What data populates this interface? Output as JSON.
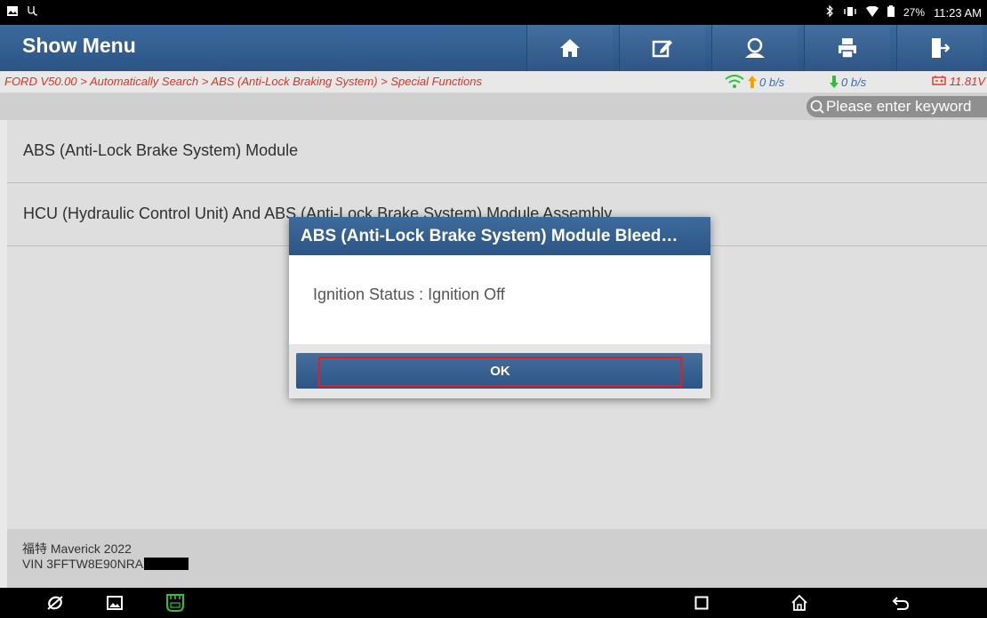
{
  "statusbar": {
    "battery": "27%",
    "time": "11:23 AM"
  },
  "header": {
    "title": "Show Menu"
  },
  "breadcrumb": {
    "path": "FORD V50.00 > Automatically Search > ABS (Anti-Lock Braking System) > Special Functions"
  },
  "network": {
    "upload": "0 b/s",
    "download": "0 b/s",
    "voltage": "11.81V"
  },
  "search": {
    "placeholder": "Please enter keyword"
  },
  "list": {
    "items": [
      {
        "label": "ABS (Anti-Lock Brake System) Module"
      },
      {
        "label": "HCU (Hydraulic Control Unit) And ABS (Anti-Lock Brake System) Module Assembly"
      }
    ]
  },
  "footer": {
    "vehicle": "福特 Maverick 2022",
    "vin": "VIN 3FFTW8E90NRA"
  },
  "dialog": {
    "title": "ABS (Anti-Lock Brake System) Module Bleed…",
    "message": "Ignition Status : Ignition Off",
    "ok_label": "OK"
  },
  "colors": {
    "accent": "#2c5585",
    "breadcrumb": "#e0311e",
    "highlight": "#e02020"
  }
}
